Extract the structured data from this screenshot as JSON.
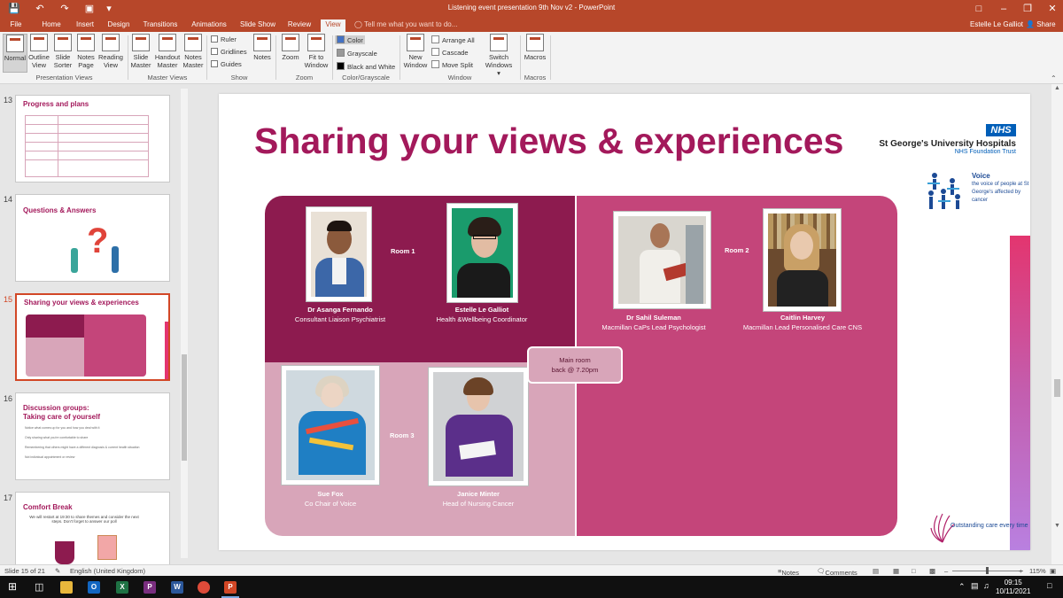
{
  "window": {
    "title": "Listening event presentation 9th Nov v2  -  PowerPoint",
    "user": "Estelle Le Galliot",
    "share_label": "Share",
    "tell_me": "Tell me what you want to do..."
  },
  "tabs": [
    "File",
    "Home",
    "Insert",
    "Design",
    "Transitions",
    "Animations",
    "Slide Show",
    "Review",
    "View"
  ],
  "active_tab": "View",
  "ribbon": {
    "presentation_views": {
      "label": "Presentation Views",
      "buttons": [
        "Normal",
        "Outline View",
        "Slide Sorter",
        "Notes Page",
        "Reading View"
      ]
    },
    "master_views": {
      "label": "Master Views",
      "buttons": [
        "Slide Master",
        "Handout Master",
        "Notes Master"
      ]
    },
    "show": {
      "label": "Show",
      "checks": [
        "Ruler",
        "Gridlines",
        "Guides"
      ],
      "notes": "Notes"
    },
    "zoom": {
      "label": "Zoom",
      "buttons": [
        "Zoom",
        "Fit to Window"
      ]
    },
    "color": {
      "label": "Color/Grayscale",
      "options": [
        "Color",
        "Grayscale",
        "Black and White"
      ]
    },
    "window": {
      "label": "Window",
      "new_window": "New Window",
      "small": [
        "Arrange All",
        "Cascade",
        "Move Split"
      ],
      "switch": "Switch Windows"
    },
    "macros": {
      "label": "Macros",
      "button": "Macros"
    }
  },
  "thumbnails": [
    {
      "num": "13",
      "title": "Progress and plans"
    },
    {
      "num": "14",
      "title": "Questions & Answers"
    },
    {
      "num": "15",
      "title": "Sharing your views & experiences"
    },
    {
      "num": "16",
      "title": "Discussion groups:",
      "title2": "Taking care of yourself"
    },
    {
      "num": "17",
      "title": "Comfort Break",
      "body": "We will restart at 19:30 to share themes and consider the next steps. Don't forget to answer our poll"
    }
  ],
  "thumb16_lines": [
    "Notice what comes up for you and how you deal with it",
    "Only sharing what you're comfortable to share",
    "Remembering that others might have a different diagnosis & current health situation",
    "Not individual appointment or review"
  ],
  "slide": {
    "title": "Sharing your views & experiences",
    "nhs": "NHS",
    "org": "St George's University Hospitals",
    "org_sub": "NHS Foundation Trust",
    "voice_title": "Voice",
    "voice_sub": "the voice of people at St George's affected by cancer",
    "outstanding": "Outstanding care every time",
    "rooms": {
      "room1": "Room 1",
      "room2": "Room 2",
      "room3": "Room 3",
      "main_line1": "Main room",
      "main_line2": "back @ 7.20pm"
    },
    "people": [
      {
        "name": "Dr Asanga Fernando",
        "role": "Consultant Liaison Psychiatrist"
      },
      {
        "name": "Estelle Le Galliot",
        "role": "Health &Wellbeing Coordinator"
      },
      {
        "name": "Dr Sahil Suleman",
        "role": "Macmillan CaPs Lead Psychologist"
      },
      {
        "name": "Caitlin Harvey",
        "role": "Macmillan Lead Personalised Care CNS"
      },
      {
        "name": "Sue Fox",
        "role": "Co Chair of Voice"
      },
      {
        "name": "Janice Minter",
        "role": "Head of Nursing Cancer"
      }
    ]
  },
  "status": {
    "slide_of": "Slide 15 of 21",
    "language": "English (United Kingdom)",
    "notes": "Notes",
    "comments": "Comments",
    "zoom": "115%"
  },
  "clock": {
    "time": "09:15",
    "date": "10/11/2021"
  }
}
